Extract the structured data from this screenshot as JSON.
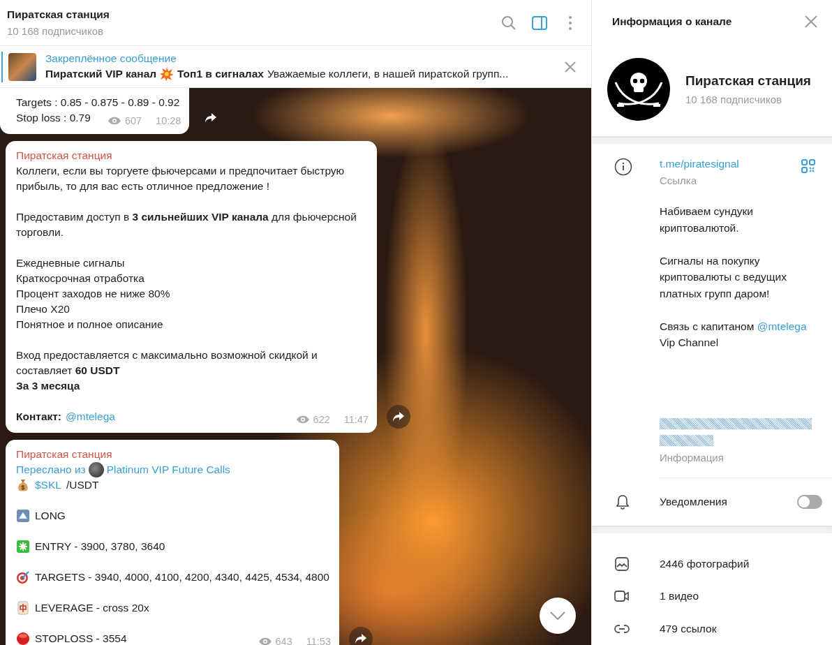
{
  "chat_header": {
    "title": "Пиратская станция",
    "subtitle": "10 168 подписчиков",
    "buttons": [
      {
        "kind": "search",
        "selected": false
      },
      {
        "kind": "panel",
        "selected": true
      },
      {
        "kind": "more",
        "selected": false
      }
    ]
  },
  "pinned": {
    "label": "Закреплённое сообщение",
    "title_start": "Пиратский VIP канал",
    "title_end": "Топ1 в сигналах",
    "text": "Уважаемые коллеги, в нашей пиратской групп..."
  },
  "messages": [
    {
      "cut_top": true,
      "paragraphs": [
        [
          {
            "parts": [
              {
                "kind": "text",
                "text": "Targets : 0.85 - 0.875 - 0.89 - 0.92"
              }
            ]
          },
          {
            "parts": [
              {
                "kind": "text",
                "text": "Stop loss : 0.79"
              }
            ]
          }
        ]
      ],
      "views": "607",
      "time": "10:28"
    },
    {
      "cut_top": false,
      "author": "Пиратская станция",
      "paragraphs": [
        [
          {
            "parts": [
              {
                "kind": "text",
                "text": "Коллеги, если вы торгуете фьючерсами и предпочитает быструю прибыль, то для вас есть отличное предложение !"
              }
            ]
          }
        ],
        [
          {
            "parts": [
              {
                "kind": "text",
                "text": "Предоставим доступ в **3 сильнейших VIP канала** для фьючерсной торговли."
              }
            ]
          }
        ],
        [
          {
            "parts": [
              {
                "kind": "text",
                "text": "Ежедневные сигналы"
              }
            ]
          },
          {
            "parts": [
              {
                "kind": "text",
                "text": "Краткосрочная отработка"
              }
            ]
          },
          {
            "parts": [
              {
                "kind": "text",
                "text": "Процент заходов не ниже 80%"
              }
            ]
          },
          {
            "parts": [
              {
                "kind": "text",
                "text": "Плечо X20"
              }
            ]
          },
          {
            "parts": [
              {
                "kind": "text",
                "text": "Понятное и полное описание"
              }
            ]
          }
        ],
        [
          {
            "parts": [
              {
                "kind": "text",
                "text": "Вход предоставляется с максимально возможной скидкой и составляет **60 USDT**"
              }
            ]
          },
          {
            "parts": [
              {
                "kind": "bold",
                "text": "За 3 месяца"
              }
            ]
          }
        ],
        [
          {
            "parts": [
              {
                "kind": "bold",
                "text": "Контакт:"
              },
              {
                "kind": "link",
                "text": "@mtelega"
              }
            ]
          }
        ]
      ],
      "views": "622",
      "time": "11:47"
    },
    {
      "cut_top": false,
      "author": "Пиратская станция",
      "forwarded": {
        "label": "Переслано из",
        "source": "Platinum VIP Future Calls"
      },
      "paragraphs": [
        [
          {
            "kind": "bag",
            "parts": [
              {
                "kind": "link",
                "text": "$SKL"
              },
              {
                "kind": "text",
                "text": "/USDT"
              }
            ]
          }
        ],
        [
          {
            "kind": "up",
            "parts": [
              {
                "kind": "text",
                "text": "LONG"
              }
            ]
          }
        ],
        [
          {
            "kind": "asterisk",
            "parts": [
              {
                "kind": "text",
                "text": "ENTRY - 3900, 3780, 3640"
              }
            ]
          }
        ],
        [
          {
            "kind": "target",
            "parts": [
              {
                "kind": "text",
                "text": "TARGETS - 3940, 4000, 4100, 4200, 4340, 4425, 4534, 4800"
              }
            ]
          }
        ],
        [
          {
            "kind": "tile",
            "parts": [
              {
                "kind": "text",
                "text": "LEVERAGE -  cross 20x"
              }
            ]
          }
        ],
        [
          {
            "kind": "dot",
            "parts": [
              {
                "kind": "text",
                "text": "STOPLOSS - 3554"
              }
            ]
          }
        ]
      ],
      "views": "643",
      "time": "11:53"
    }
  ],
  "info_panel": {
    "title": "Информация о канале",
    "name": "Пиратская станция",
    "subtitle": "10 168 подписчиков",
    "link": {
      "value": "t.me/piratesignal",
      "label": "Ссылка"
    },
    "description": [
      [
        {
          "kind": "text",
          "text": "Набиваем сундуки криптовалютой."
        }
      ],
      [
        {
          "kind": "text",
          "text": "Сигналы на покупку криптовалюты с ведущих платных групп даром!"
        }
      ],
      [
        {
          "kind": "text",
          "text": "Связь с капитаном"
        },
        {
          "kind": "link",
          "text": "@mtelega"
        },
        {
          "kind": "text",
          "text": "Vip Channel"
        }
      ]
    ],
    "description_label": "Информация",
    "notifications": {
      "label": "Уведомления",
      "on": false
    },
    "media": [
      {
        "kind": "photos",
        "text": "2446 фотографий"
      },
      {
        "kind": "videos",
        "text": "1 видео"
      },
      {
        "kind": "links",
        "text": "479 ссылок"
      }
    ]
  }
}
